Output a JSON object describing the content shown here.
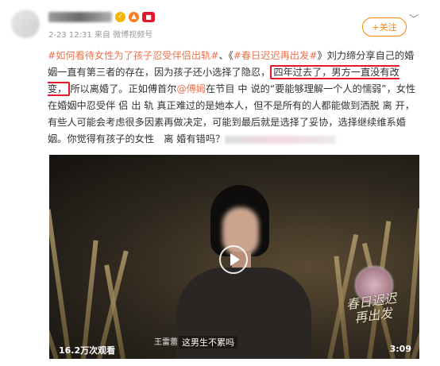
{
  "post": {
    "time": "2-23 12:31",
    "source_prefix": "来自",
    "source": "微博视频号",
    "follow_label": "+关注",
    "more_icon": "chevron-down-icon",
    "topics": [
      "#如何看待女性为了孩子忍受伴侣出轨#",
      "#春日迟迟再出发#"
    ],
    "separator": "、《",
    "close_quote": "》",
    "text_1": "刘力缔分享自己的婚姻一直有第三者的存在，因为孩子还小选择了隐忍，",
    "highlight": "四年过去了，男方一直没有改变，",
    "text_2": "所以离婚了。正如傅首尔",
    "mention": "@傅姆",
    "text_3": "在节目 中 说的“要能够理解一个人的懦弱”，女性在婚姻中忍受伴 侣 出 轨 真正难过的是她本人，但不是所有的人都能做到洒脱 离 开，有些人可能会考虑很多因素再做决定，可能到最后就是选择了妥协，选择继续维系婚姻。你觉得有孩子的女性　离 婚有错吗？"
  },
  "video": {
    "speaker": "王雷蕾",
    "subtitle": "这男生不累吗",
    "views": "16.2万次观看",
    "duration": "3:09",
    "show_logo": "春日迟迟再出发"
  },
  "colors": {
    "accent": "#ff8200",
    "link": "#eb7350",
    "highlight_border": "#e6162d"
  }
}
